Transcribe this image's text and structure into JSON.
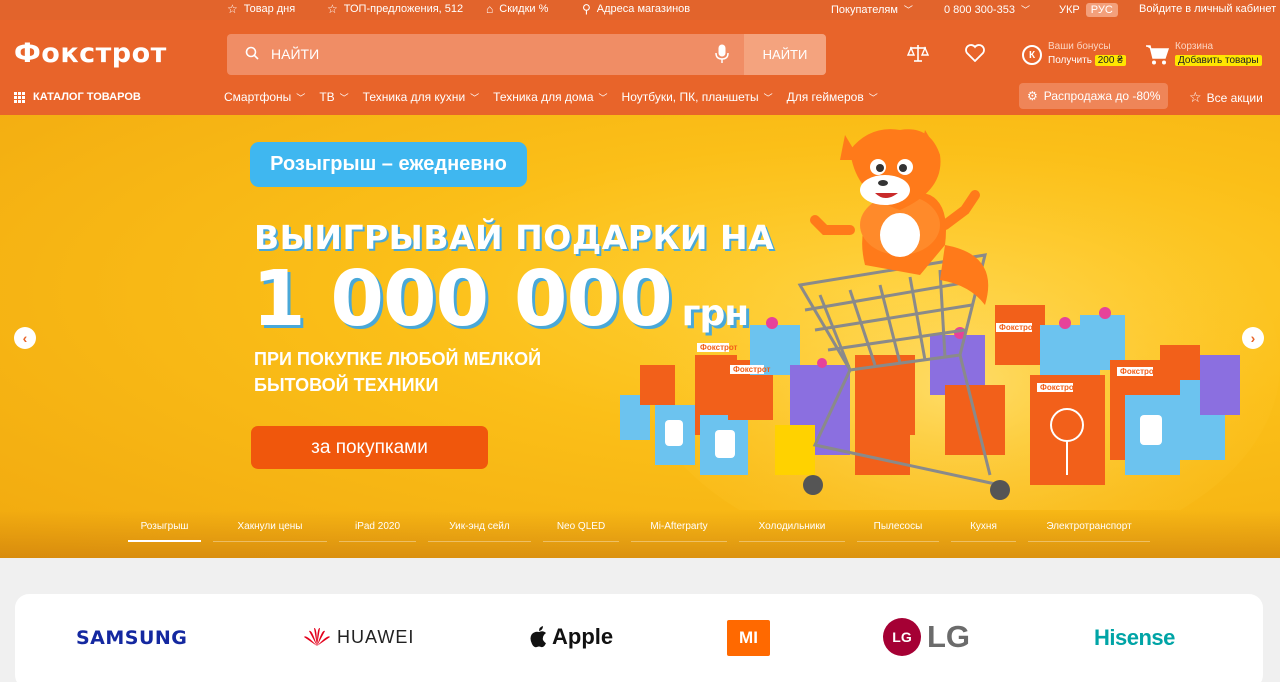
{
  "topbar": {
    "deal_day": "Товар дня",
    "top_offers": "ТОП-предложения, 512",
    "discounts": "Скидки %",
    "stores": "Адреса магазинов",
    "buyers": "Покупателям",
    "phone": "0 800 300-353",
    "lang_ukr": "УКР",
    "lang_rus": "РУС",
    "login": "Войдите в личный кабинет"
  },
  "header": {
    "logo": "Фокстрот",
    "search_placeholder": "НАЙТИ",
    "search_button": "НАЙТИ",
    "bonus_label": "Ваши бонусы",
    "bonus_get": "Получить",
    "bonus_amount": "200 ₴",
    "cart_label": "Корзина",
    "cart_add": "Добавить товары"
  },
  "nav": {
    "catalog": "КАТАЛОГ ТОВАРОВ",
    "links": [
      "Смартфоны",
      "ТВ",
      "Техника для кухни",
      "Техника для дома",
      "Ноутбуки, ПК, планшеты",
      "Для геймеров"
    ],
    "sale": "Распродажа до -80%",
    "all_actions": "Все акции"
  },
  "banner": {
    "pill": "Розыгрыш – ежедневно",
    "headline": "ВЫИГРЫВАЙ ПОДАРКИ НА",
    "amount": "1 000 000",
    "currency": "грн",
    "subline1": "ПРИ ПОКУПКЕ ЛЮБОЙ МЕЛКОЙ",
    "subline2": "БЫТОВОЙ ТЕХНИКИ",
    "cta": "за покупками",
    "box_label": "Фокстрот",
    "tabs": [
      "Розыгрыш",
      "Хакнули цены",
      "iPad 2020",
      "Уик-энд сейл",
      "Neo QLED",
      "Mi-Afterparty",
      "Холодильники",
      "Пылесосы",
      "Кухня",
      "Электротранспорт"
    ]
  },
  "brands": {
    "samsung": "SAMSUNG",
    "huawei": "HUAWEI",
    "apple": "Apple",
    "mi": "MI",
    "lg": "LG",
    "lg_circle": "LG",
    "hisense": "Hisense"
  }
}
